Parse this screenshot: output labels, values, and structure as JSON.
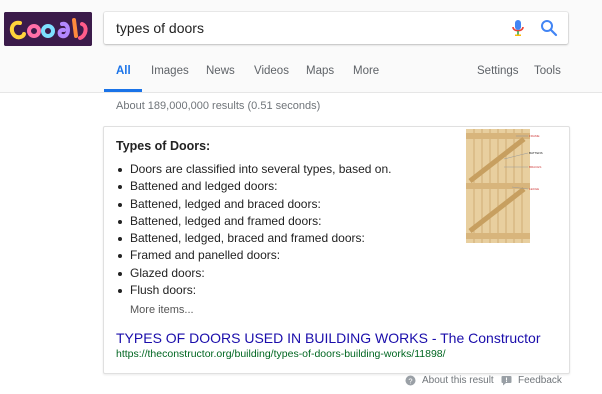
{
  "search": {
    "query": "types of doors",
    "placeholder": ""
  },
  "tabs": [
    {
      "label": "All",
      "active": true
    },
    {
      "label": "Images"
    },
    {
      "label": "News"
    },
    {
      "label": "Videos"
    },
    {
      "label": "Maps"
    },
    {
      "label": "More"
    }
  ],
  "tools": {
    "settings": "Settings",
    "tools": "Tools"
  },
  "results_count": "About 189,000,000 results (0.51 seconds)",
  "featured": {
    "title": "Types of Doors:",
    "items": [
      "Doors are classified into several types, based on.",
      "Battened and ledged doors:",
      "Battened, ledged and braced doors:",
      "Battened, ledged and framed doors:",
      "Battened, ledged, braced and framed doors:",
      "Framed and panelled doors:",
      "Glazed doors:",
      "Flush doors:"
    ],
    "more": "More items...",
    "link_title": "TYPES OF DOORS USED IN BUILDING WORKS - The Constructor",
    "link_url": "https://theconstructor.org/building/types-of-doors-building-works/11898/",
    "image_labels": [
      "FRAME",
      "BATTENS",
      "BRACES",
      "LEDGE"
    ]
  },
  "footer": {
    "about": "About this result",
    "feedback": "Feedback"
  },
  "colors": {
    "accent": "#1a73e8",
    "link": "#1a0dab",
    "url": "#006621"
  }
}
